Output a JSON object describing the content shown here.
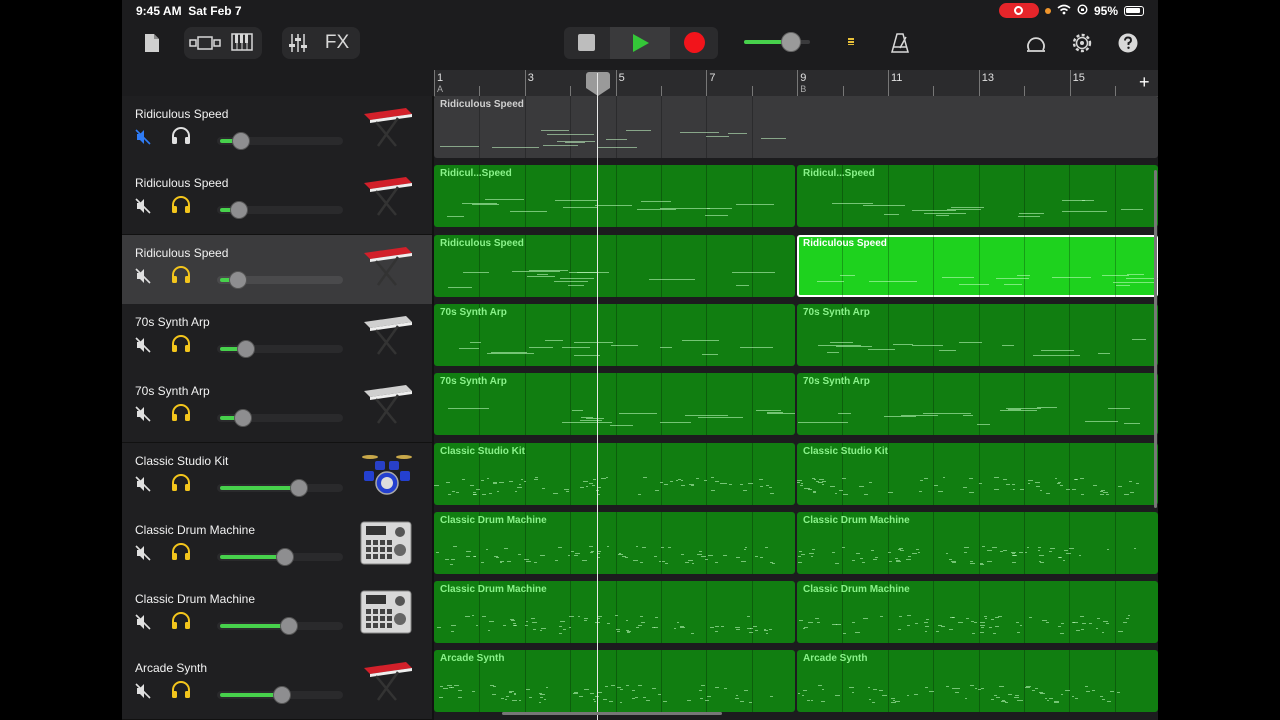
{
  "status": {
    "time": "9:45 AM",
    "date": "Sat Feb 7",
    "battery": "95%"
  },
  "toolbar": {
    "fx_label": "FX",
    "master_volume": 0.7
  },
  "ruler": {
    "numbers": [
      "1",
      "3",
      "5",
      "7",
      "9",
      "11",
      "13",
      "15"
    ],
    "sections": [
      "A",
      "B"
    ]
  },
  "colors": {
    "region": "#117e11",
    "region_selected": "#1ed21e",
    "fill": "#47d14c",
    "headphones_on": "#f3c51c",
    "mute_on": "#2f7cf6"
  },
  "tracks": [
    {
      "name": "Ridiculous Speed",
      "instrument": "keyboard-red",
      "muted": true,
      "headphones": false,
      "volume": 0.18,
      "regions": [
        {
          "label": "Ridiculous Speed",
          "style": "gray"
        }
      ]
    },
    {
      "name": "Ridiculous Speed",
      "instrument": "keyboard-red",
      "muted": false,
      "headphones": true,
      "volume": 0.17,
      "regions": [
        {
          "label": "Ridicul...Speed",
          "style": "normal"
        },
        {
          "label": "Ridicul...Speed",
          "style": "normal"
        }
      ]
    },
    {
      "name": "Ridiculous Speed",
      "instrument": "keyboard-red",
      "muted": false,
      "headphones": true,
      "volume": 0.16,
      "selected": true,
      "regions": [
        {
          "label": "Ridiculous Speed",
          "style": "normal"
        },
        {
          "label": "Ridiculous Speed",
          "style": "selected"
        }
      ]
    },
    {
      "name": "70s Synth Arp",
      "instrument": "keyboard-silver",
      "muted": false,
      "headphones": true,
      "volume": 0.22,
      "regions": [
        {
          "label": "70s Synth Arp",
          "style": "normal"
        },
        {
          "label": "70s Synth Arp",
          "style": "normal"
        }
      ]
    },
    {
      "name": "70s Synth Arp",
      "instrument": "keyboard-silver",
      "muted": false,
      "headphones": true,
      "volume": 0.2,
      "regions": [
        {
          "label": "70s Synth Arp",
          "style": "normal"
        },
        {
          "label": "70s Synth Arp",
          "style": "normal"
        }
      ]
    },
    {
      "name": "Classic Studio Kit",
      "instrument": "drum-kit",
      "muted": false,
      "headphones": true,
      "volume": 0.64,
      "regions": [
        {
          "label": "Classic Studio Kit",
          "style": "normal"
        },
        {
          "label": "Classic Studio Kit",
          "style": "normal"
        }
      ]
    },
    {
      "name": "Classic Drum Machine",
      "instrument": "drum-machine",
      "muted": false,
      "headphones": true,
      "volume": 0.53,
      "regions": [
        {
          "label": "Classic Drum Machine",
          "style": "normal"
        },
        {
          "label": "Classic Drum Machine",
          "style": "normal"
        }
      ]
    },
    {
      "name": "Classic Drum Machine",
      "instrument": "drum-machine",
      "muted": false,
      "headphones": true,
      "volume": 0.56,
      "regions": [
        {
          "label": "Classic Drum Machine",
          "style": "normal"
        },
        {
          "label": "Classic Drum Machine",
          "style": "normal"
        }
      ]
    },
    {
      "name": "Arcade Synth",
      "instrument": "keyboard-red",
      "muted": false,
      "headphones": true,
      "volume": 0.51,
      "regions": [
        {
          "label": "Arcade Synth",
          "style": "normal"
        },
        {
          "label": "Arcade Synth",
          "style": "normal"
        }
      ]
    }
  ]
}
